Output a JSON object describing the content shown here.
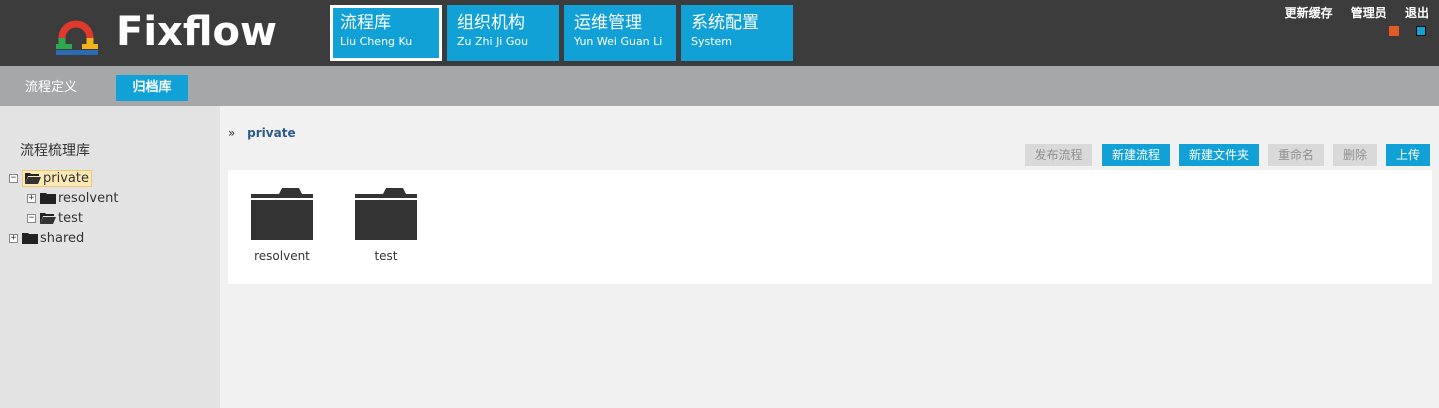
{
  "header": {
    "brand": "Fixflow",
    "nav": [
      {
        "cn": "流程库",
        "py": "Liu Cheng Ku",
        "active": true
      },
      {
        "cn": "组织机构",
        "py": "Zu Zhi Ji Gou",
        "active": false
      },
      {
        "cn": "运维管理",
        "py": "Yun Wei Guan Li",
        "active": false
      },
      {
        "cn": "系统配置",
        "py": "System",
        "active": false
      }
    ],
    "links": {
      "refresh_cache": "更新缓存",
      "admin": "管理员",
      "logout": "退出"
    },
    "theme_colors": [
      "#e45a27",
      "#12a1d7"
    ]
  },
  "subnav": {
    "tabs": [
      {
        "label": "流程定义",
        "active": false
      },
      {
        "label": "归档库",
        "active": true
      }
    ]
  },
  "sidebar": {
    "title": "流程梳理库",
    "tree": [
      {
        "label": "private",
        "toggle": "−",
        "selected": true,
        "level": 0
      },
      {
        "label": "resolvent",
        "toggle": "+",
        "selected": false,
        "level": 1
      },
      {
        "label": "test",
        "toggle": "−",
        "selected": false,
        "level": 1
      },
      {
        "label": "shared",
        "toggle": "+",
        "selected": false,
        "level": 0
      }
    ]
  },
  "main": {
    "breadcrumb": {
      "arrow": "»",
      "current": "private"
    },
    "toolbar": {
      "publish": "发布流程",
      "new_process": "新建流程",
      "new_folder": "新建文件夹",
      "rename": "重命名",
      "delete": "删除",
      "upload": "上传"
    },
    "folders": [
      {
        "name": "resolvent"
      },
      {
        "name": "test"
      }
    ]
  },
  "colors": {
    "accent": "#12a1d7",
    "header_bg": "#3c3c3c",
    "subnav_bg": "#a6a7a9"
  }
}
